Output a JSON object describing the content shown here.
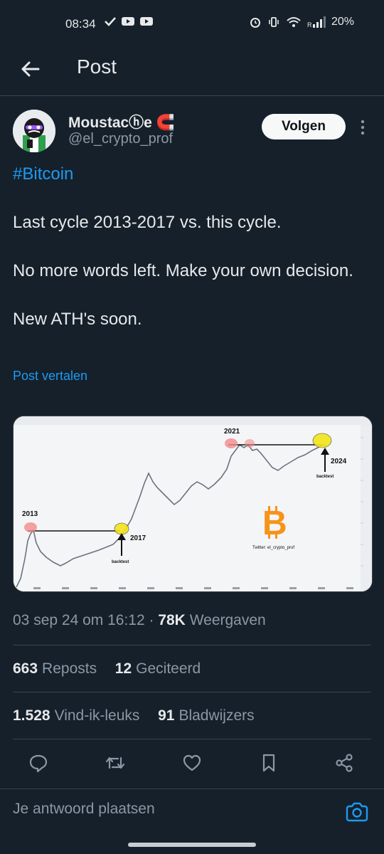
{
  "status_bar": {
    "time": "08:34",
    "battery": "20%"
  },
  "header": {
    "title": "Post"
  },
  "author": {
    "display_name": "Moustacⓗe 🧲",
    "handle": "@el_crypto_prof",
    "follow_label": "Volgen"
  },
  "tweet": {
    "hashtag": "#Bitcoin",
    "lines": [
      "Last cycle 2013-2017 vs. this cycle.",
      "No more words left. Make your own decision.",
      "New ATH's soon."
    ],
    "translate_label": "Post vertalen"
  },
  "media": {
    "labels": {
      "y2013": "2013",
      "y2017": "2017",
      "y2021": "2021",
      "y2024": "2024",
      "backtest": "backtest",
      "credit": "Twitter: el_crypto_prof"
    }
  },
  "meta": {
    "timestamp": "03 sep 24 om 16:12",
    "separator": "·",
    "views_count": "78K",
    "views_label": "Weergaven"
  },
  "stats": {
    "reposts_count": "663",
    "reposts_label": "Reposts",
    "quotes_count": "12",
    "quotes_label": "Geciteerd",
    "likes_count": "1.528",
    "likes_label": "Vind-ik-leuks",
    "bookmarks_count": "91",
    "bookmarks_label": "Bladwijzers"
  },
  "reply": {
    "placeholder": "Je antwoord plaatsen"
  },
  "colors": {
    "background": "#15202b",
    "accent": "#1d9bf0",
    "muted": "#8b98a5"
  }
}
